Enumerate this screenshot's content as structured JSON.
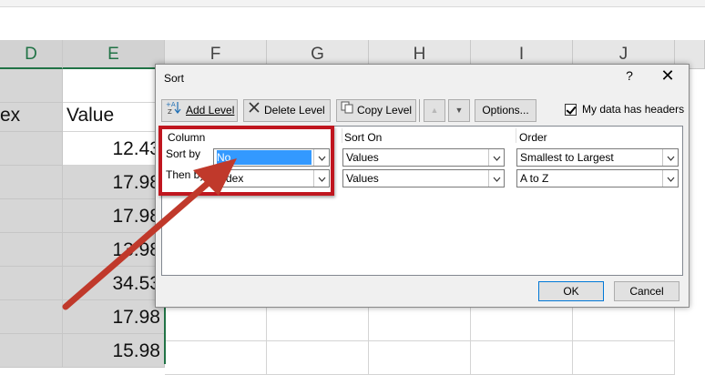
{
  "spreadsheet": {
    "columns": [
      {
        "letter": "D",
        "selected": true
      },
      {
        "letter": "E",
        "selected": true
      },
      {
        "letter": "F",
        "selected": false
      },
      {
        "letter": "G",
        "selected": false
      },
      {
        "letter": "H",
        "selected": false
      },
      {
        "letter": "I",
        "selected": false
      },
      {
        "letter": "J",
        "selected": false
      }
    ],
    "header_row": {
      "d": "ex",
      "e": "Value"
    },
    "values": [
      "12.43",
      "17.98",
      "17.98",
      "13.98",
      "34.53",
      "17.98",
      "15.98"
    ]
  },
  "dialog": {
    "title": "Sort",
    "help": "?",
    "close": "✕",
    "toolbar": {
      "add_level": "Add Level",
      "delete_level": "Delete Level",
      "copy_level": "Copy Level",
      "options": "Options...",
      "my_data_has_headers": "My data has headers",
      "headers_checked": true
    },
    "columns_header": {
      "column": "Column",
      "sort_on": "Sort On",
      "order": "Order"
    },
    "rows": [
      {
        "label": "Sort by",
        "column": "No.",
        "sort_on": "Values",
        "order": "Smallest to Largest"
      },
      {
        "label": "Then by",
        "column": "Index",
        "sort_on": "Values",
        "order": "A to Z"
      }
    ],
    "ok": "OK",
    "cancel": "Cancel"
  },
  "colors": {
    "annotation_red": "#c0161f",
    "excel_green": "#217346",
    "selection_blue": "#3399ff"
  }
}
